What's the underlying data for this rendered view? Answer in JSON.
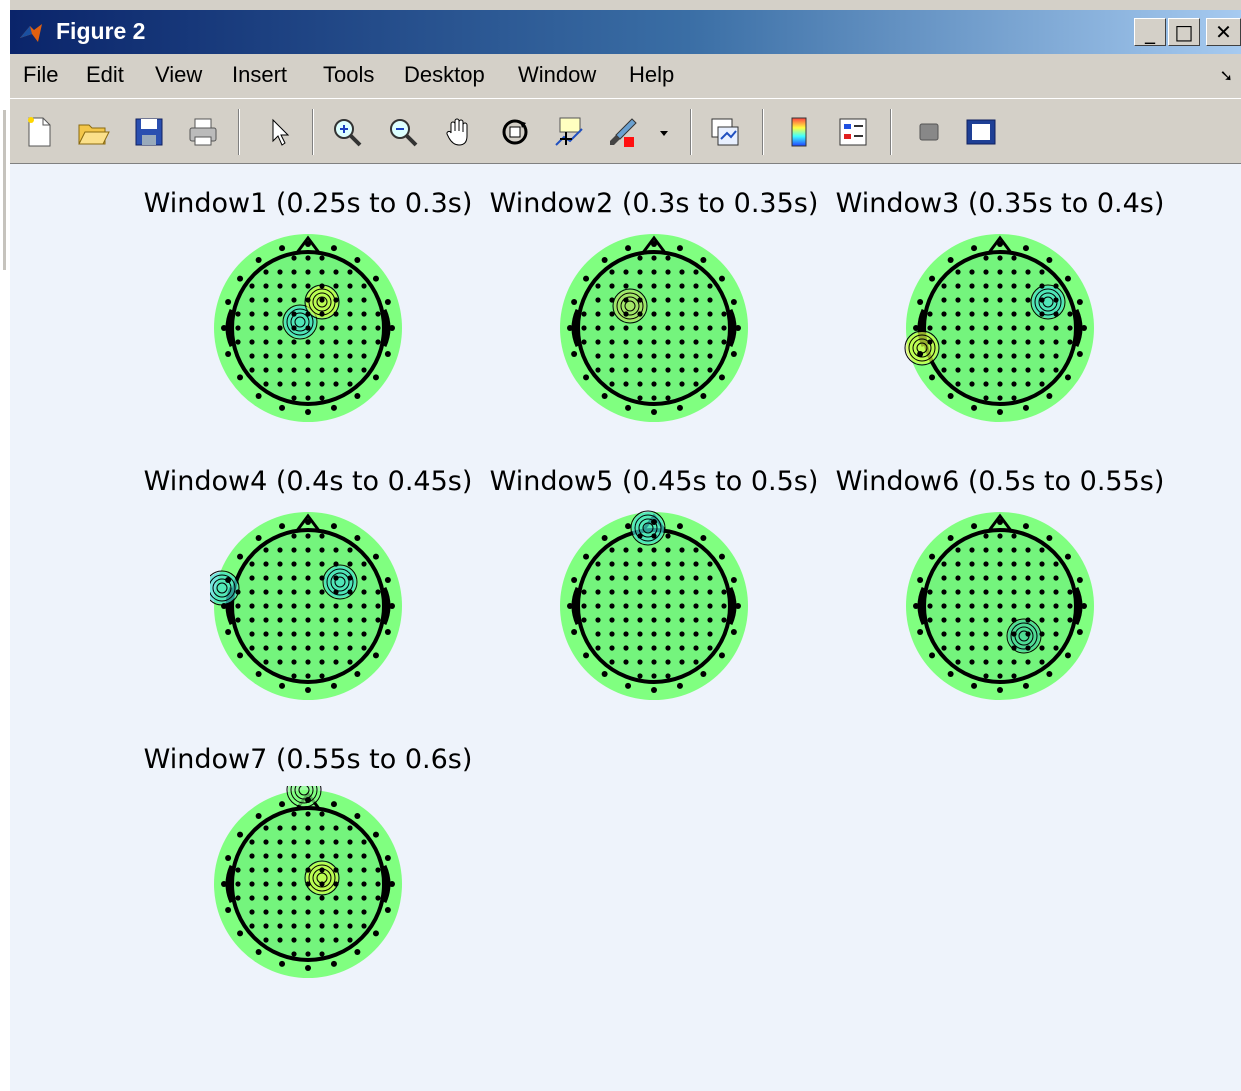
{
  "window": {
    "title": "Figure 2",
    "controls": {
      "minimize": "_",
      "maximize": "□",
      "close": "✕"
    }
  },
  "menu": [
    "File",
    "Edit",
    "View",
    "Insert",
    "Tools",
    "Desktop",
    "Window",
    "Help"
  ],
  "toolbar": [
    "new-figure-icon",
    "open-file-icon",
    "save-icon",
    "print-icon",
    "select-arrow-icon",
    "zoom-in-icon",
    "zoom-out-icon",
    "pan-hand-icon",
    "rotate-3d-icon",
    "data-cursor-icon",
    "brush-icon",
    "brush-dropdown-icon",
    "link-plot-icon",
    "colorbar-icon",
    "legend-icon",
    "hide-plot-tools-icon",
    "show-plot-tools-icon"
  ],
  "colors": {
    "head_fill": "#80ff80",
    "head_inner": "#66e67a",
    "canvas_bg": "#eef3fb",
    "contour": "#000000",
    "accent_cyan": "#40e0d0",
    "accent_yellow": "#d8ff40"
  },
  "plots": [
    {
      "title": "Window1 (0.25s to 0.3s)"
    },
    {
      "title": "Window2 (0.3s to 0.35s)"
    },
    {
      "title": "Window3 (0.35s to 0.4s)"
    },
    {
      "title": "Window4 (0.4s to 0.45s)"
    },
    {
      "title": "Window5 (0.45s to 0.5s)"
    },
    {
      "title": "Window6 (0.5s to 0.55s)"
    },
    {
      "title": "Window7 (0.55s to 0.6s)"
    }
  ]
}
